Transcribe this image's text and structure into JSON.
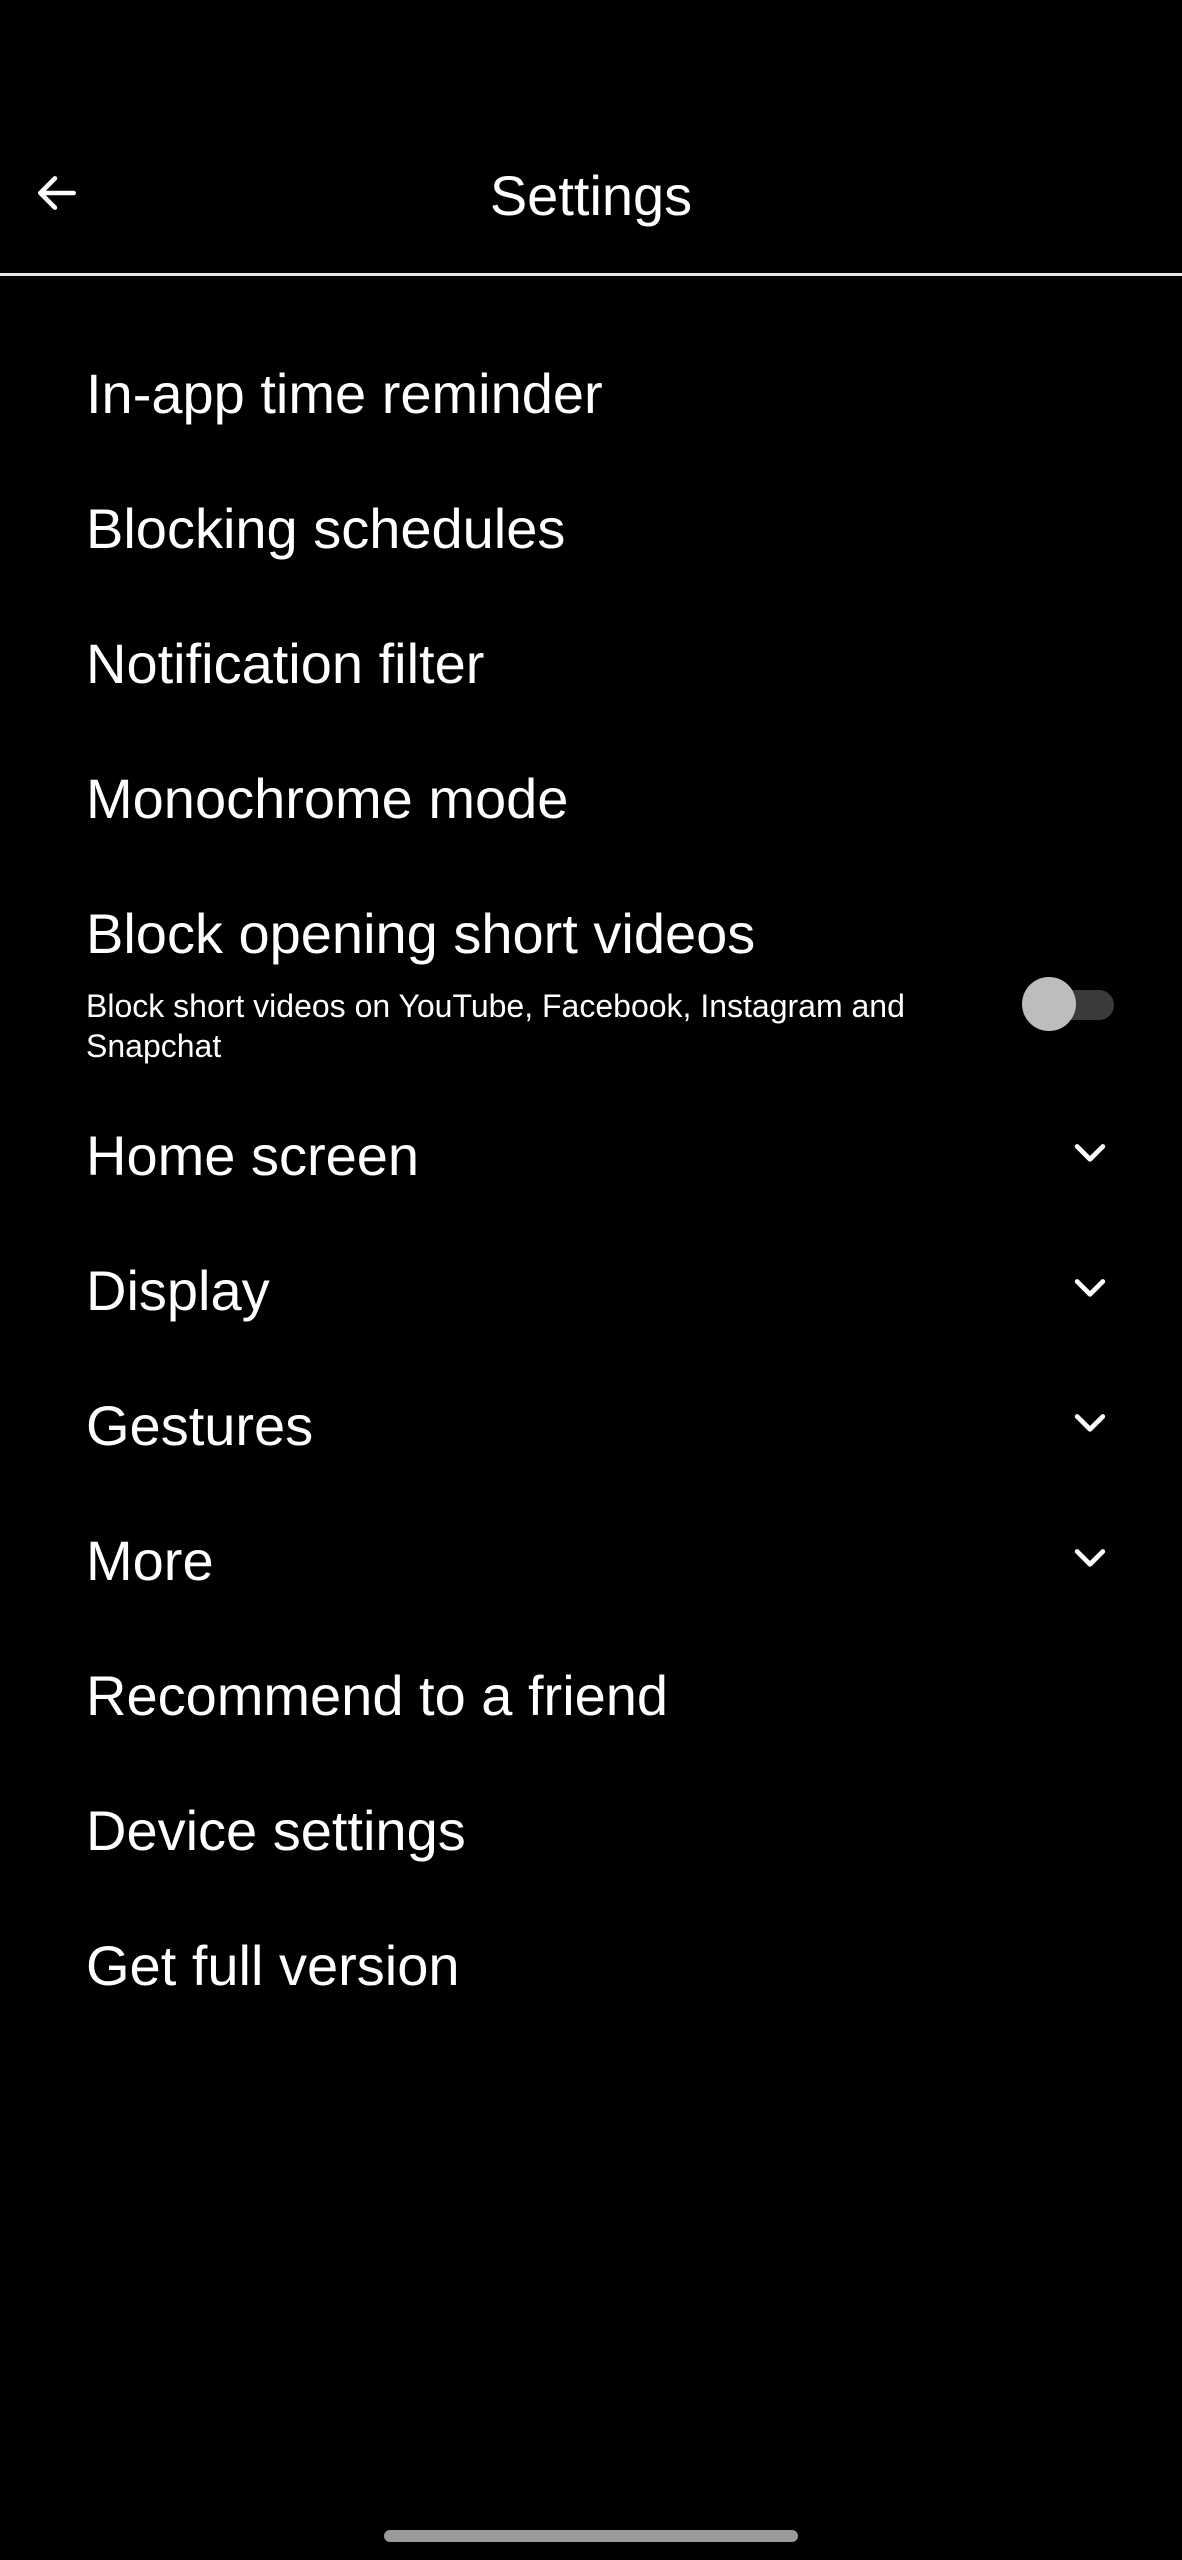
{
  "header": {
    "title": "Settings",
    "back_icon": "arrow-left-icon"
  },
  "items": [
    {
      "label": "In-app time reminder"
    },
    {
      "label": "Blocking schedules"
    },
    {
      "label": "Notification filter"
    },
    {
      "label": "Monochrome mode"
    }
  ],
  "toggle_item": {
    "label": "Block opening short videos",
    "description": "Block short videos on YouTube, Facebook, Instagram and Snapchat",
    "enabled": false
  },
  "expandable_items": [
    {
      "label": "Home screen",
      "icon": "chevron-down-icon"
    },
    {
      "label": "Display",
      "icon": "chevron-down-icon"
    },
    {
      "label": "Gestures",
      "icon": "chevron-down-icon"
    },
    {
      "label": "More",
      "icon": "chevron-down-icon"
    }
  ],
  "bottom_items": [
    {
      "label": "Recommend to a friend"
    },
    {
      "label": "Device settings"
    },
    {
      "label": "Get full version"
    }
  ],
  "colors": {
    "background": "#000000",
    "text": "#ffffff",
    "divider": "#e6e6e6",
    "switch_thumb": "#bdbdbd",
    "switch_track": "#3a3a3a"
  }
}
